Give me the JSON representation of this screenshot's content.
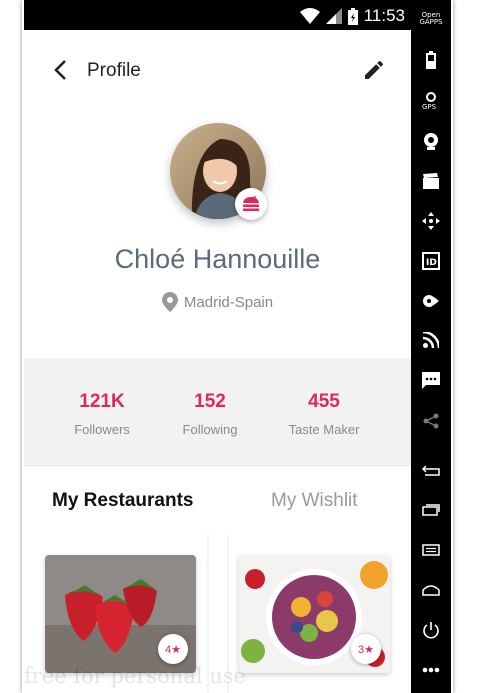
{
  "status_bar": {
    "time": "11:53",
    "icons": [
      "wifi-icon",
      "signal-icon",
      "battery-icon"
    ]
  },
  "emulator_panel": {
    "logo": "Open GAPPS",
    "buttons": [
      "battery-icon",
      "gps-icon",
      "webcam-icon",
      "clapper-icon",
      "move-icon",
      "id-icon",
      "media-icon",
      "rss-icon",
      "message-icon",
      "share-icon",
      "back-icon",
      "recents-icon",
      "menu-icon",
      "home-icon",
      "power-icon",
      "more-icon"
    ]
  },
  "header": {
    "title": "Profile",
    "back_icon": "chevron-left-icon",
    "edit_icon": "pencil-icon"
  },
  "profile": {
    "name": "Chloé Hannouille",
    "location": "Madrid-Spain"
  },
  "stats": [
    {
      "value": "121K",
      "label": "Followers"
    },
    {
      "value": "152",
      "label": "Following"
    },
    {
      "value": "455",
      "label": "Taste Maker"
    }
  ],
  "tabs": {
    "active": "My Restaurants",
    "inactive": "My Wishlit"
  },
  "cards": [
    {
      "image": "strawberries",
      "rating": "4★"
    },
    {
      "image": "fruit-bowl",
      "rating": "3★"
    }
  ],
  "watermark": "free for personal use",
  "colors": {
    "accent": "#e0265f",
    "name": "#5a6b7b",
    "stats_bg": "#f2f2f2"
  }
}
